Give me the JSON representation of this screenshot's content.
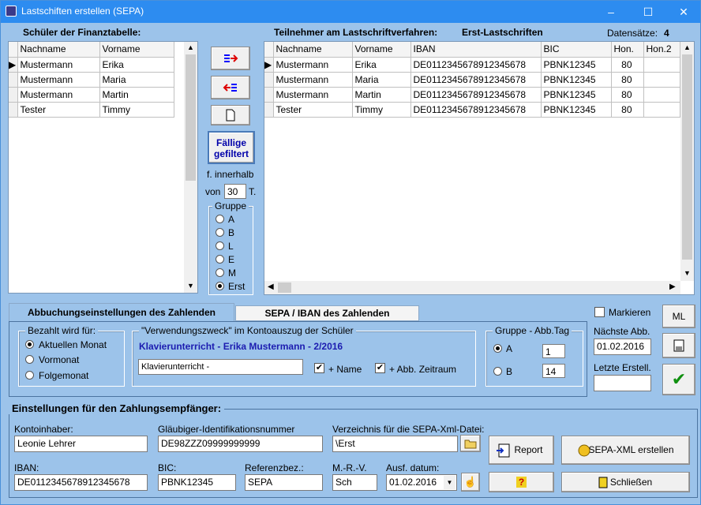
{
  "window": {
    "title": "Lastschiften erstellen (SEPA)",
    "min": "–",
    "max": "☐",
    "close": "✕"
  },
  "left": {
    "title": "Schüler der Finanztabelle:",
    "columns": [
      "Nachname",
      "Vorname"
    ],
    "rows": [
      [
        "Mustermann",
        "Erika"
      ],
      [
        "Mustermann",
        "Maria"
      ],
      [
        "Mustermann",
        "Martin"
      ],
      [
        "Tester",
        "Timmy"
      ]
    ]
  },
  "right": {
    "title": "Teilnehmer am Lastschriftverfahren:",
    "type": "Erst-Lastschriften",
    "count_label": "Datensätze:",
    "count": "4",
    "columns": [
      "Nachname",
      "Vorname",
      "IBAN",
      "BIC",
      "Hon.",
      "Hon.2"
    ],
    "rows": [
      [
        "Mustermann",
        "Erika",
        "DE0112345678912345678",
        "PBNK12345",
        "80",
        ""
      ],
      [
        "Mustermann",
        "Maria",
        "DE0112345678912345678",
        "PBNK12345",
        "80",
        ""
      ],
      [
        "Mustermann",
        "Martin",
        "DE0112345678912345678",
        "PBNK12345",
        "80",
        ""
      ],
      [
        "Tester",
        "Timmy",
        "DE0112345678912345678",
        "PBNK12345",
        "80",
        ""
      ]
    ]
  },
  "middle": {
    "faellig_line1": "Fällige",
    "faellig_line2": "gefiltert",
    "innerhalb": "f. innerhalb",
    "von": "von",
    "days": "30",
    "t": "T.",
    "gruppe": "Gruppe",
    "groups": [
      "A",
      "B",
      "L",
      "E",
      "M",
      "Erst"
    ],
    "selected_group": "Erst"
  },
  "tabs": {
    "t1": "Abbuchungseinstellungen des Zahlenden",
    "t2": "SEPA  / IBAN  des Zahlenden"
  },
  "bezahlt": {
    "title": "Bezahlt wird für:",
    "options": [
      "Aktuellen Monat",
      "Vormonat",
      "Folgemonat"
    ],
    "selected": "Aktuellen Monat"
  },
  "zweck": {
    "title": "\"Verwendungszweck\" im Kontoauszug der Schüler",
    "preview": "Klavierunterricht - Erika Mustermann - 2/2016",
    "value": "Klavierunterricht -",
    "name_label": "+ Name",
    "zeitraum_label": "+ Abb. Zeitraum",
    "name_checked": "✔",
    "zeitraum_checked": "✔"
  },
  "abbtag": {
    "title": "Gruppe - Abb.Tag",
    "a_label": "A",
    "a_value": "1",
    "b_label": "B",
    "b_value": "14"
  },
  "side": {
    "markieren": "Markieren",
    "ml": "ML",
    "naechste_label": "Nächste Abb.",
    "naechste": "01.02.2016",
    "letzte_label": "Letzte Erstell.",
    "letzte": ""
  },
  "empf": {
    "title": "Einstellungen für den Zahlungsempfänger:",
    "kontoinhaber_label": "Kontoinhaber:",
    "kontoinhaber": "Leonie Lehrer",
    "glaeubiger_label": "Gläubiger-Identifikationsnummer",
    "glaeubiger": "DE98ZZZ09999999999",
    "verz_label": "Verzeichnis für die SEPA-Xml-Datei:",
    "verz": "\\Erst",
    "iban_label": "IBAN:",
    "iban": "DE0112345678912345678",
    "bic_label": "BIC:",
    "bic": "PBNK12345",
    "ref_label": "Referenzbez.:",
    "ref": "SEPA",
    "mrv_label": "M.-R.-V.",
    "mrv": "Sch",
    "ausf_label": "Ausf. datum:",
    "ausf": "01.02.2016"
  },
  "buttons": {
    "report": "Report",
    "sepa": "SEPA-XML erstellen",
    "help": "?",
    "close": "Schließen"
  }
}
